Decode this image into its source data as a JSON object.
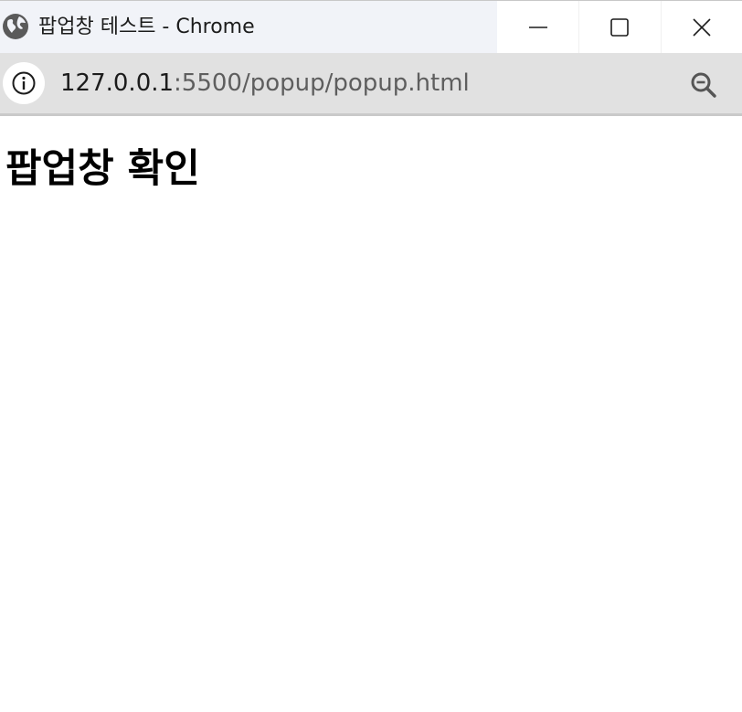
{
  "window": {
    "title": "팝업창 테스트 - Chrome",
    "controls": {
      "minimize_icon": "minimize-icon",
      "maximize_icon": "maximize-icon",
      "close_icon": "close-icon"
    }
  },
  "addressbar": {
    "url_host": "127.0.0.1",
    "url_rest": ":5500/popup/popup.html",
    "info_icon": "info-icon",
    "zoom_icon": "zoom-out-icon"
  },
  "page": {
    "heading": "팝업창 확인"
  },
  "colors": {
    "titlebar_bg": "#f1f3f8",
    "addressbar_bg": "#e1e1e1",
    "url_path": "#5e5e5e",
    "icon": "#555555"
  }
}
